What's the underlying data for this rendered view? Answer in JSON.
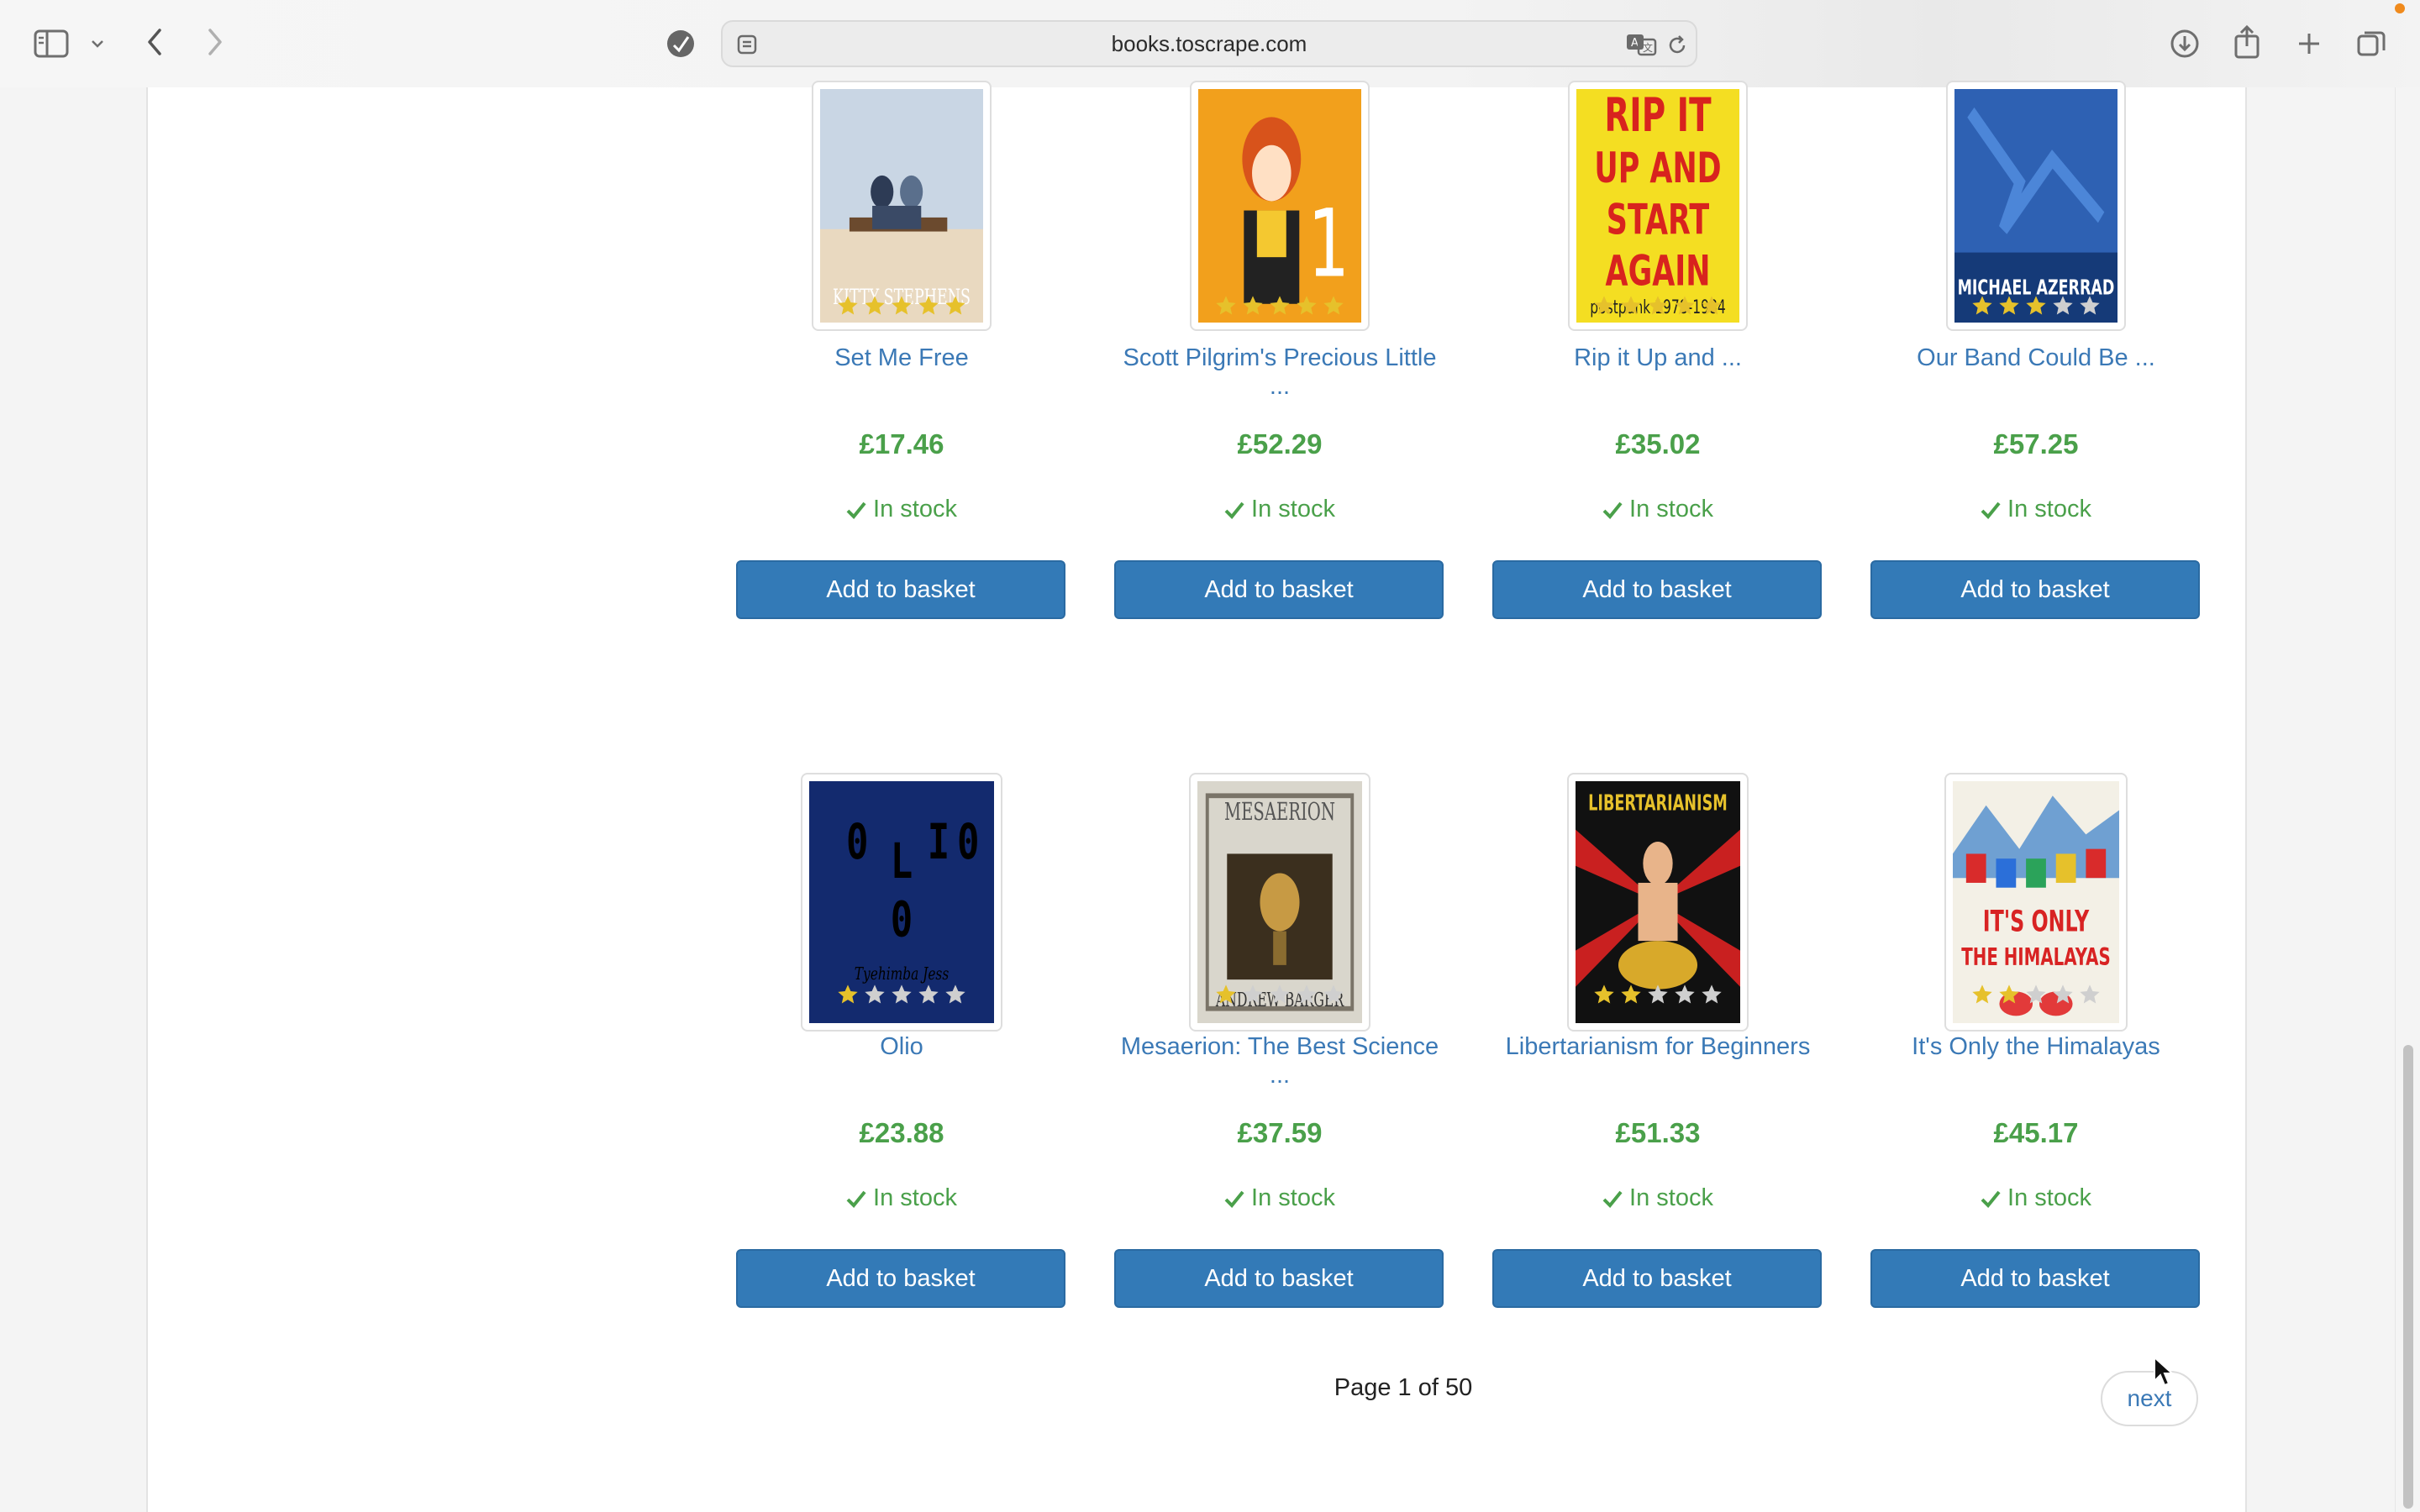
{
  "browser": {
    "url": "books.toscrape.com"
  },
  "products": [
    {
      "title": "Set Me Free",
      "title_line2": "",
      "price": "£17.46",
      "rating": 5,
      "stock": "In stock",
      "button": "Add to basket",
      "cover_icon": "book-cover-set-me-free",
      "cover_text": "KITTY STEPHENS"
    },
    {
      "title": "Scott Pilgrim's Precious Little",
      "title_line2": "...",
      "price": "£52.29",
      "rating": 5,
      "stock": "In stock",
      "button": "Add to basket",
      "cover_icon": "book-cover-scott-pilgrim",
      "cover_text": "1"
    },
    {
      "title": "Rip it Up and ...",
      "title_line2": "",
      "price": "£35.02",
      "rating": 5,
      "stock": "In stock",
      "button": "Add to basket",
      "cover_icon": "book-cover-rip-it-up",
      "cover_text": "RIP IT UP AND START AGAIN"
    },
    {
      "title": "Our Band Could Be ...",
      "title_line2": "",
      "price": "£57.25",
      "rating": 3,
      "stock": "In stock",
      "button": "Add to basket",
      "cover_icon": "book-cover-our-band",
      "cover_text": "MICHAEL AZERRAD"
    },
    {
      "title": "Olio",
      "title_line2": "",
      "price": "£23.88",
      "rating": 1,
      "stock": "In stock",
      "button": "Add to basket",
      "cover_icon": "book-cover-olio",
      "cover_text": "OLIO"
    },
    {
      "title": "Mesaerion: The Best Science",
      "title_line2": "...",
      "price": "£37.59",
      "rating": 1,
      "stock": "In stock",
      "button": "Add to basket",
      "cover_icon": "book-cover-mesaerion",
      "cover_text": "ANDREW BARGER"
    },
    {
      "title": "Libertarianism for Beginners",
      "title_line2": "",
      "price": "£51.33",
      "rating": 2,
      "stock": "In stock",
      "button": "Add to basket",
      "cover_icon": "book-cover-libertarianism",
      "cover_text": "LIBERTARIANISM"
    },
    {
      "title": "It's Only the Himalayas",
      "title_line2": "",
      "price": "£45.17",
      "rating": 2,
      "stock": "In stock",
      "button": "Add to basket",
      "cover_icon": "book-cover-himalayas",
      "cover_text": "IT'S ONLY THE HIMALAYAS"
    }
  ],
  "pagination": {
    "text": "Page 1 of 50",
    "next_label": "next"
  },
  "colors": {
    "star_on": "#e6c12b",
    "star_off": "#cfcfcf",
    "button": "#337ab7",
    "price": "#4aa04a",
    "link": "#3b79b6"
  }
}
